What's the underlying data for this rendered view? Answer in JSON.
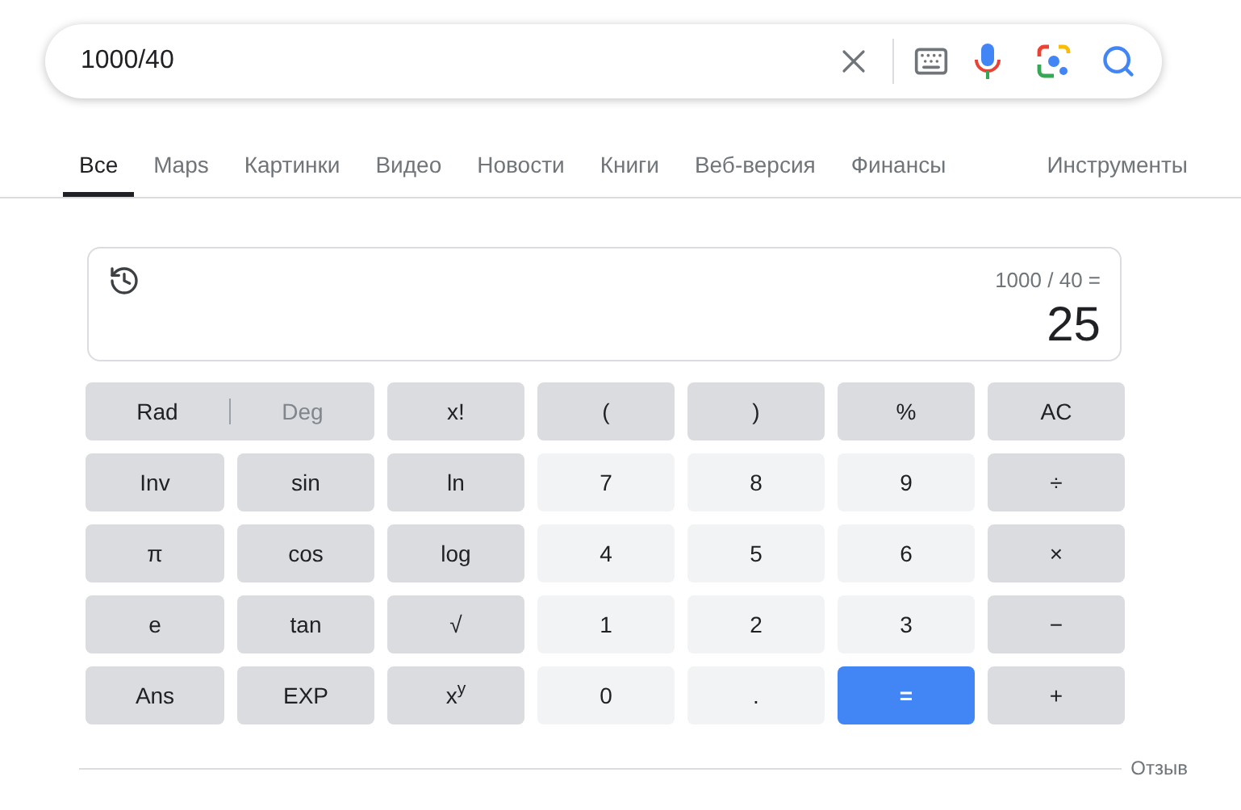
{
  "search": {
    "value": "1000/40"
  },
  "tabs": [
    {
      "label": "Все",
      "selected": true
    },
    {
      "label": "Maps",
      "selected": false
    },
    {
      "label": "Картинки",
      "selected": false
    },
    {
      "label": "Видео",
      "selected": false
    },
    {
      "label": "Новости",
      "selected": false
    },
    {
      "label": "Книги",
      "selected": false
    },
    {
      "label": "Веб-версия",
      "selected": false
    },
    {
      "label": "Финансы",
      "selected": false
    }
  ],
  "tools": "Инструменты",
  "calculator": {
    "expression": "1000 / 40 =",
    "result": "25",
    "angle_modes": [
      {
        "label": "Rad",
        "selected": true
      },
      {
        "label": "Deg",
        "selected": false
      }
    ],
    "keys": [
      {
        "label": "x!",
        "kind": "function"
      },
      {
        "label": "(",
        "kind": "function"
      },
      {
        "label": ")",
        "kind": "function"
      },
      {
        "label": "%",
        "kind": "function"
      },
      {
        "label": "AC",
        "kind": "function"
      },
      {
        "label": "Inv",
        "kind": "function"
      },
      {
        "label": "sin",
        "kind": "function"
      },
      {
        "label": "ln",
        "kind": "function"
      },
      {
        "label": "7",
        "kind": "digit"
      },
      {
        "label": "8",
        "kind": "digit"
      },
      {
        "label": "9",
        "kind": "digit"
      },
      {
        "label": "÷",
        "kind": "function"
      },
      {
        "label": "π",
        "kind": "function"
      },
      {
        "label": "cos",
        "kind": "function"
      },
      {
        "label": "log",
        "kind": "function"
      },
      {
        "label": "4",
        "kind": "digit"
      },
      {
        "label": "5",
        "kind": "digit"
      },
      {
        "label": "6",
        "kind": "digit"
      },
      {
        "label": "×",
        "kind": "function"
      },
      {
        "label": "e",
        "kind": "function"
      },
      {
        "label": "tan",
        "kind": "function"
      },
      {
        "label": "√",
        "kind": "function"
      },
      {
        "label": "1",
        "kind": "digit"
      },
      {
        "label": "2",
        "kind": "digit"
      },
      {
        "label": "3",
        "kind": "digit"
      },
      {
        "label": "−",
        "kind": "function"
      },
      {
        "label": "Ans",
        "kind": "function"
      },
      {
        "label": "EXP",
        "kind": "function"
      },
      {
        "label": "x$^{y}$",
        "kind": "function"
      },
      {
        "label": "0",
        "kind": "digit"
      },
      {
        "label": ".",
        "kind": "digit"
      },
      {
        "label": "=",
        "kind": "equals"
      },
      {
        "label": "+",
        "kind": "function"
      }
    ]
  },
  "feedback": "Отзыв"
}
